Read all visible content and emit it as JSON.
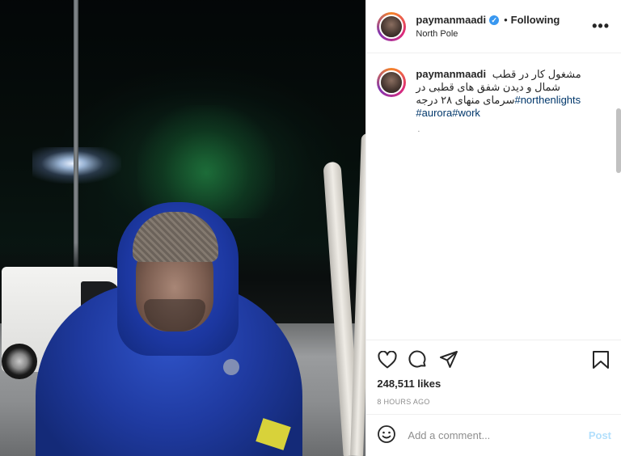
{
  "header": {
    "username": "paymanmaadi",
    "verified_glyph": "✓",
    "separator": "•",
    "follow_label": "Following",
    "location": "North Pole",
    "more_glyph": "•••"
  },
  "caption": {
    "username": "paymanmaadi",
    "text_fa": "مشغول کار در قطب شمال و دیدن شفق های قطبی در سرمای منهای ۲۸ درجه",
    "hashtags": [
      "#northenlights",
      "#aurora",
      "#work"
    ],
    "small_note": "‌."
  },
  "actions": {
    "icons": [
      "heart-icon",
      "comment-icon",
      "share-icon",
      "bookmark-icon"
    ],
    "likes": "248,511 likes",
    "time": "8 HOURS AGO"
  },
  "comment_box": {
    "placeholder": "Add a comment...",
    "post_label": "Post",
    "emoji_icon": "emoji-icon"
  },
  "colors": {
    "link": "#00376b",
    "verified": "#3897f0",
    "post_disabled": "#b2dffc",
    "border": "#efefef"
  }
}
